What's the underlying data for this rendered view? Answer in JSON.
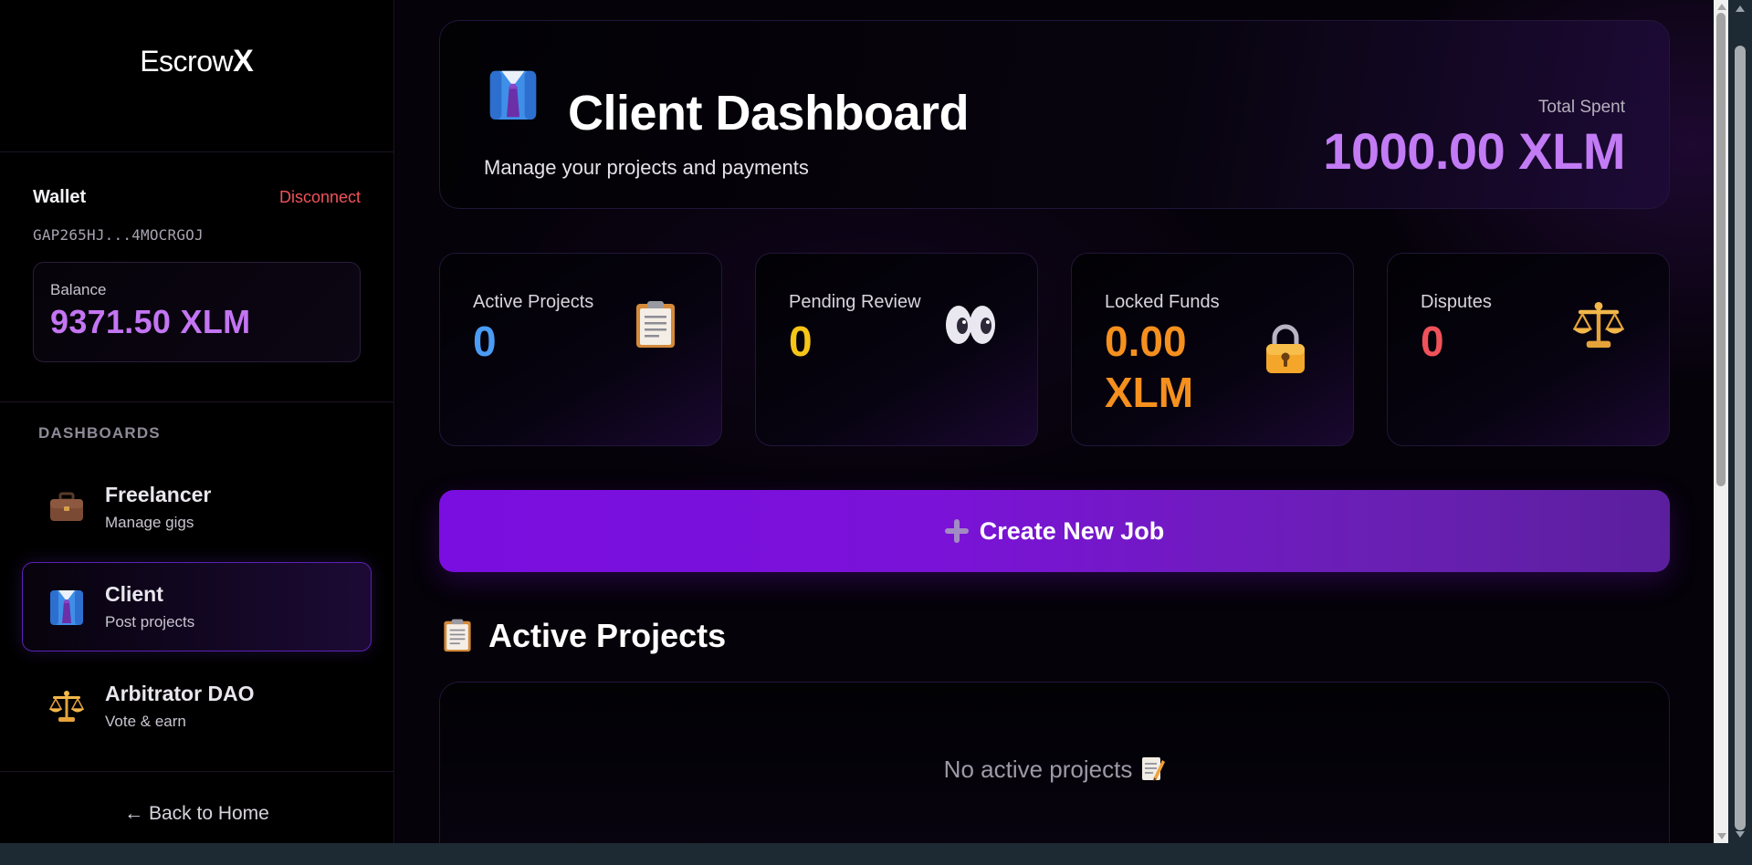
{
  "sidebar": {
    "brand": {
      "name": "Escrow",
      "mark": "X"
    },
    "wallet": {
      "title": "Wallet",
      "disconnect_label": "Disconnect",
      "address": "GAP265HJ...4MOCRGOJ",
      "balance_label": "Balance",
      "balance_value": "9371.50 XLM"
    },
    "dashboards_heading": "DASHBOARDS",
    "items": [
      {
        "label": "Freelancer",
        "sub": "Manage gigs",
        "icon": "briefcase-icon",
        "active": false
      },
      {
        "label": "Client",
        "sub": "Post projects",
        "icon": "suit-icon",
        "active": true
      },
      {
        "label": "Arbitrator DAO",
        "sub": "Vote & earn",
        "icon": "scales-icon",
        "active": false
      }
    ],
    "back_home": "← Back to Home"
  },
  "header": {
    "title": "Client Dashboard",
    "subtitle": "Manage your projects and payments",
    "total_spent_label": "Total Spent",
    "total_spent_value": "1000.00 XLM",
    "icon": "suit-icon"
  },
  "stats": [
    {
      "label": "Active Projects",
      "value": "0",
      "color": "#4a9cf5",
      "icon": "clipboard-icon"
    },
    {
      "label": "Pending Review",
      "value": "0",
      "color": "#f5c518",
      "icon": "eyes-icon"
    },
    {
      "label": "Locked Funds",
      "value": "0.00 XLM",
      "color": "#f5901e",
      "icon": "lock-icon"
    },
    {
      "label": "Disputes",
      "value": "0",
      "color": "#f0525a",
      "icon": "scales-icon"
    }
  ],
  "create_job_label": "Create New Job",
  "active_projects": {
    "title": "Active Projects",
    "empty_text": "No active projects"
  },
  "colors": {
    "accent": "#c27bf5",
    "button": "#7a0ee0",
    "danger": "#f0525a"
  }
}
